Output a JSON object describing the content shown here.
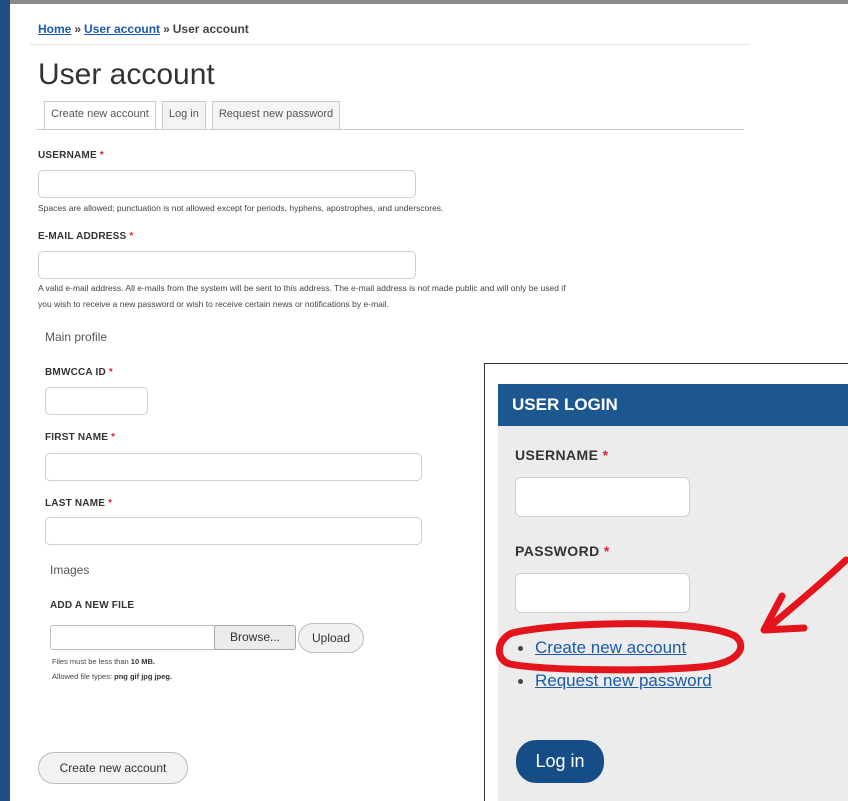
{
  "breadcrumb": {
    "home": "Home",
    "sep1": "»",
    "user_account_link": "User account",
    "sep2": "»",
    "current": "User account"
  },
  "page": {
    "title": "User account"
  },
  "tabs": [
    {
      "label": "Create new account",
      "active": true
    },
    {
      "label": "Log in",
      "active": false
    },
    {
      "label": "Request new password",
      "active": false
    }
  ],
  "form": {
    "username": {
      "label": "USERNAME",
      "required": "*",
      "value": "",
      "description": "Spaces are allowed; punctuation is not allowed except for periods, hyphens, apostrophes, and underscores."
    },
    "email": {
      "label": "E-MAIL ADDRESS",
      "required": "*",
      "value": "",
      "description_line1": "A valid e-mail address. All e-mails from the system will be sent to this address. The e-mail address is not made public and will only be used if",
      "description_line2": "you wish to receive a new password or wish to receive certain news or notifications by e-mail."
    },
    "main_profile_heading": "Main profile",
    "bmwcca_id": {
      "label": "BMWCCA ID",
      "required": "*",
      "value": ""
    },
    "first_name": {
      "label": "FIRST NAME",
      "required": "*",
      "value": ""
    },
    "last_name": {
      "label": "LAST NAME",
      "required": "*",
      "value": ""
    },
    "images_heading": "Images",
    "add_file": {
      "label": "ADD A NEW FILE",
      "browse_label": "Browse...",
      "upload_label": "Upload",
      "help_size_prefix": "Files must be less than",
      "help_size_value": "10 MB.",
      "help_types_prefix": "Allowed file types:",
      "help_types_value": "png gif jpg jpeg."
    },
    "submit_label": "Create new account"
  },
  "login_block": {
    "title": "USER LOGIN",
    "username_label": "USERNAME",
    "password_label": "PASSWORD",
    "required": "*",
    "links": [
      {
        "label": "Create new account"
      },
      {
        "label": "Request new password"
      }
    ],
    "submit_label": "Log in"
  },
  "annotation": {
    "color": "#e3141b",
    "shape": "circle-and-arrow",
    "target": "Create new account"
  },
  "colors": {
    "link": "#1b5aa8",
    "required": "#d9262f",
    "header_blue": "#1d5790",
    "button_blue": "#174d86",
    "sidebar_blue": "#1f4e86"
  }
}
